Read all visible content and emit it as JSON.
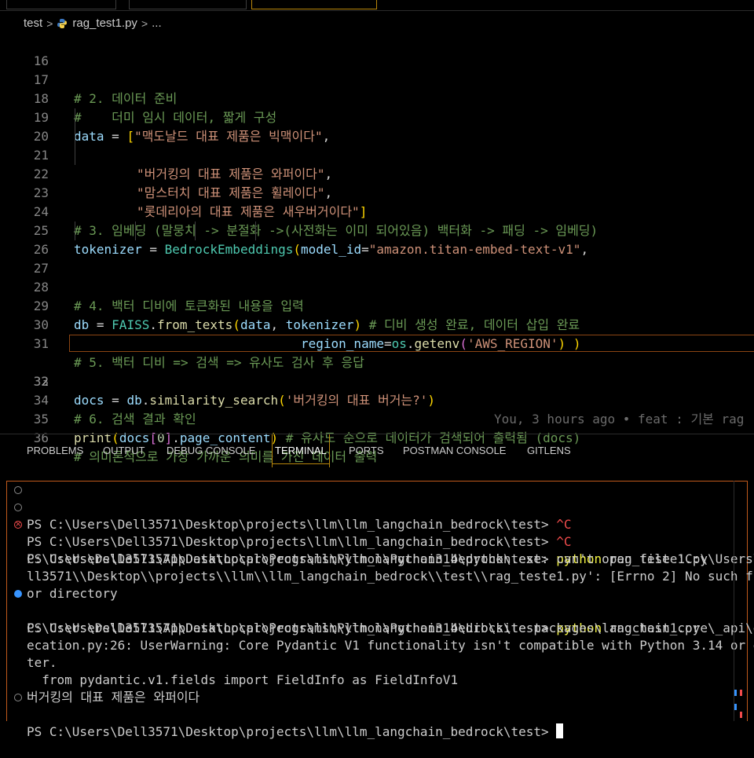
{
  "breadcrumb": {
    "folder": "test",
    "file": "rag_test1.py",
    "more": "..."
  },
  "editor": {
    "lines": [
      {
        "n": "16"
      },
      {
        "n": "17",
        "comment": "# 2. 데이터 준비"
      },
      {
        "n": "18",
        "comment": "#    더미 임시 데이터, 짧게 구성"
      },
      {
        "n": "19",
        "var": "data",
        "op": " = ",
        "open": "[",
        "str": "\"맥도날드 대표 제품은 빅맥이다\"",
        "after": ","
      },
      {
        "n": "20",
        "str": "\"버거킹의 대표 제품은 와퍼이다\"",
        "after": ","
      },
      {
        "n": "21",
        "str": "\"맘스터치 대표 제품은 휠레이다\"",
        "after": ","
      },
      {
        "n": "22",
        "str": "\"롯데리아의 대표 제품은 새우버거이다\"",
        "close": "]"
      },
      {
        "n": "23"
      },
      {
        "n": "24",
        "comment": "# 3. 임베딩 (말뭉치 -> 분절화 ->(사전화는 이미 되어있음) 백터화 -> 패딩 -> 임베딩)"
      },
      {
        "n": "25",
        "var": "tokenizer",
        "op": " = ",
        "cls": "BedrockEmbeddings",
        "open": "(",
        "param": "model_id",
        "eq": "=",
        "str": "\"amazon.titan-embed-text-v1\"",
        "after": ","
      },
      {
        "n": "26",
        "param": "region_name",
        "eq": "=",
        "obj": "os",
        "dot": ".",
        "fn": "getenv",
        "open": "(",
        "str": "'AWS_REGION'",
        "close": ") )"
      },
      {
        "n": "27"
      },
      {
        "n": "28",
        "comment": "# 4. 백터 디비에 토큰화된 내용을 입력"
      },
      {
        "n": "29",
        "var": "db",
        "op": " = ",
        "cls": "FAISS",
        "dot": ".",
        "fn": "from_texts",
        "open": "(",
        "a1": "data",
        "comma": ", ",
        "a2": "tokenizer",
        "close": ")",
        "comment": " # 디비 생성 완료, 데이터 삽입 완료"
      },
      {
        "n": "30"
      },
      {
        "n": "31",
        "comment": "# 5. 백터 디비 => 검색 => 유사도 검사 후 응답"
      },
      {
        "n": "32",
        "var": "docs",
        "op": " = ",
        "obj": "db",
        "dot": ".",
        "fn": "similarity_search",
        "open": "(",
        "str": "'버거킹의 대표 버거는?'",
        "close": ")",
        "blame": "You, 3 hours ago • feat : 기본 rag"
      },
      {
        "n": "33"
      },
      {
        "n": "34",
        "comment": "# 6. 검색 결과 확인"
      },
      {
        "n": "35",
        "fn": "print",
        "open": "(",
        "var": "docs",
        "b2open": "[",
        "num": "0",
        "b2close": "]",
        "dot": ".",
        "attr": "page_content",
        "close": ")",
        "comment": " # 유사도 순으로 데이터가 검색되어 출력됨 (docs)"
      },
      {
        "n": "36",
        "comment": "# 의미론적으로 가장 가까운 의미를 가진 데이터 출력"
      }
    ]
  },
  "panel": {
    "tabs": [
      "PROBLEMS",
      "OUTPUT",
      "DEBUG CONSOLE",
      "TERMINAL",
      "PORTS",
      "POSTMAN CONSOLE",
      "GITLENS"
    ],
    "active_tab": "TERMINAL"
  },
  "terminal": {
    "prompt": "PS C:\\Users\\Dell3571\\Desktop\\projects\\llm\\llm_langchain_bedrock\\test> ",
    "interrupt": "^C",
    "cmd1": "python",
    "cmd1_args": " rag_teste1.py",
    "err1": "C:\\Users\\Dell3571\\AppData\\Local\\Programs\\Python\\Python314\\python.exe: can't open file 'C:\\\\Users\\\\De",
    "err2": "ll3571\\\\Desktop\\\\projects\\\\llm\\\\llm_langchain_bedrock\\\\test\\\\rag_teste1.py': [Errno 2] No such file",
    "err3": "or directory",
    "cmd2": "python",
    "cmd2_args": " rag_test1.py",
    "warn1": "C:\\Users\\Dell3571\\AppData\\Local\\Programs\\Python\\Python314\\Lib\\site-packages\\langchain_core\\_api\\depr",
    "warn2": "ecation.py:26: UserWarning: Core Pydantic V1 functionality isn't compatible with Python 3.14 or grea",
    "warn3": "ter.",
    "warn4": "  from pydantic.v1.fields import FieldInfo as FieldInfoV1",
    "output": "버거킹의 대표 제품은 와퍼이다"
  },
  "colors": {
    "accent": "#b8860b",
    "terminal_border": "#c05a1c",
    "error": "#f14c4c",
    "success": "#3794ff",
    "command": "#f5f543"
  }
}
